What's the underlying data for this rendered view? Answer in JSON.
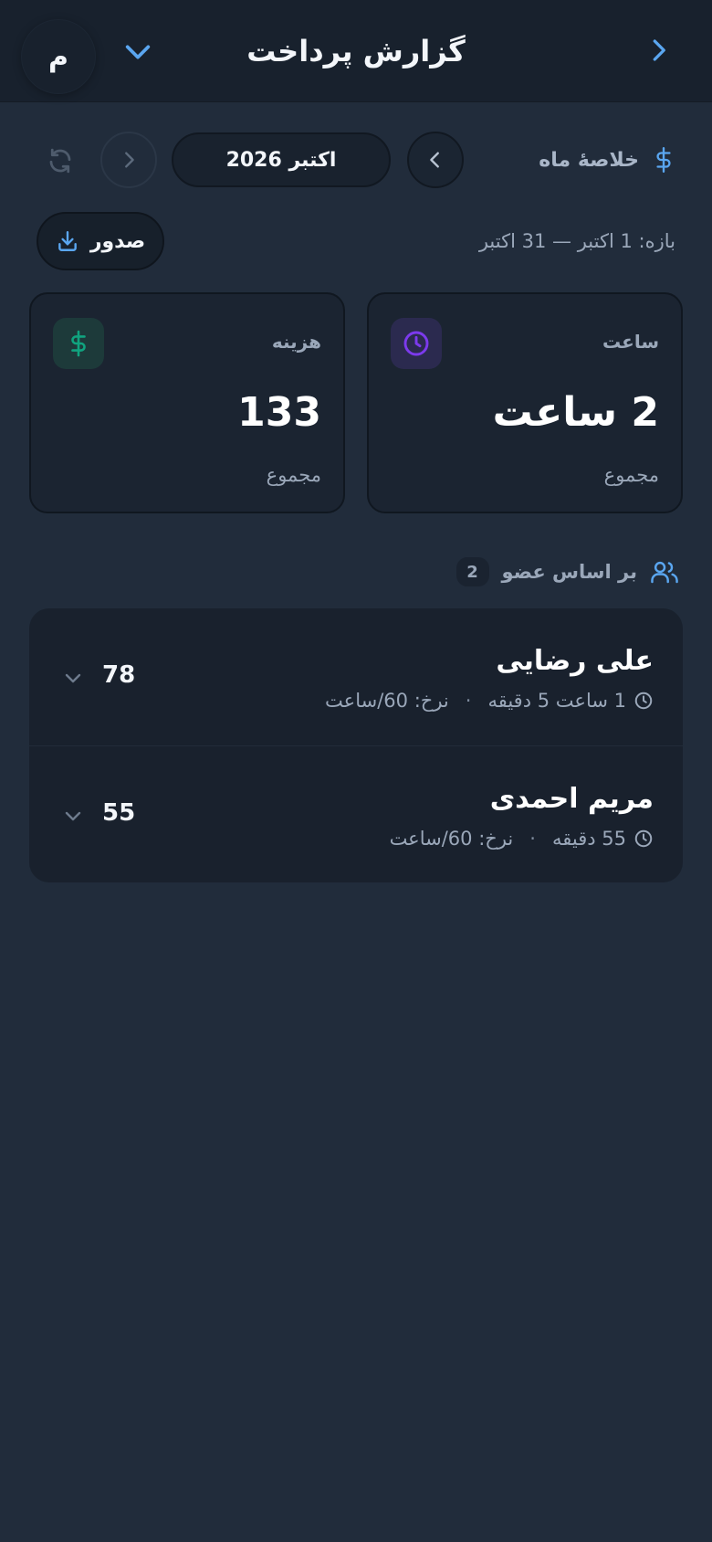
{
  "header": {
    "title": "گزارش پرداخت",
    "avatar_initial": "م",
    "back_icon": "chevron-right-icon",
    "menu_icon": "chevron-down-icon"
  },
  "period": {
    "summary_label": "خلاصهٔ ماه",
    "month_label": "اکتبر 2026",
    "range_text": "بازه: 1 اکتبر — 31 اکتبر",
    "export_label": "صدور"
  },
  "stats": {
    "hours": {
      "label": "ساعت",
      "value": "2 ساعت",
      "sub": "مجموع"
    },
    "cost": {
      "label": "هزینه",
      "value": "133",
      "sub": "مجموع"
    }
  },
  "members": {
    "heading": "بر اساس عضو",
    "count": "2",
    "items": [
      {
        "name": "علی رضایی",
        "duration": "1 ساعت 5 دقیقه",
        "rate": "نرخ: 60/ساعت",
        "amount": "78"
      },
      {
        "name": "مریم احمدی",
        "duration": "55 دقیقه",
        "rate": "نرخ: 60/ساعت",
        "amount": "55"
      }
    ]
  },
  "colors": {
    "background": "#212c3b",
    "header": "#18212d",
    "accent_blue": "#5aa6f0",
    "accent_purple": "#7c3aed",
    "accent_green": "#10a37f"
  }
}
